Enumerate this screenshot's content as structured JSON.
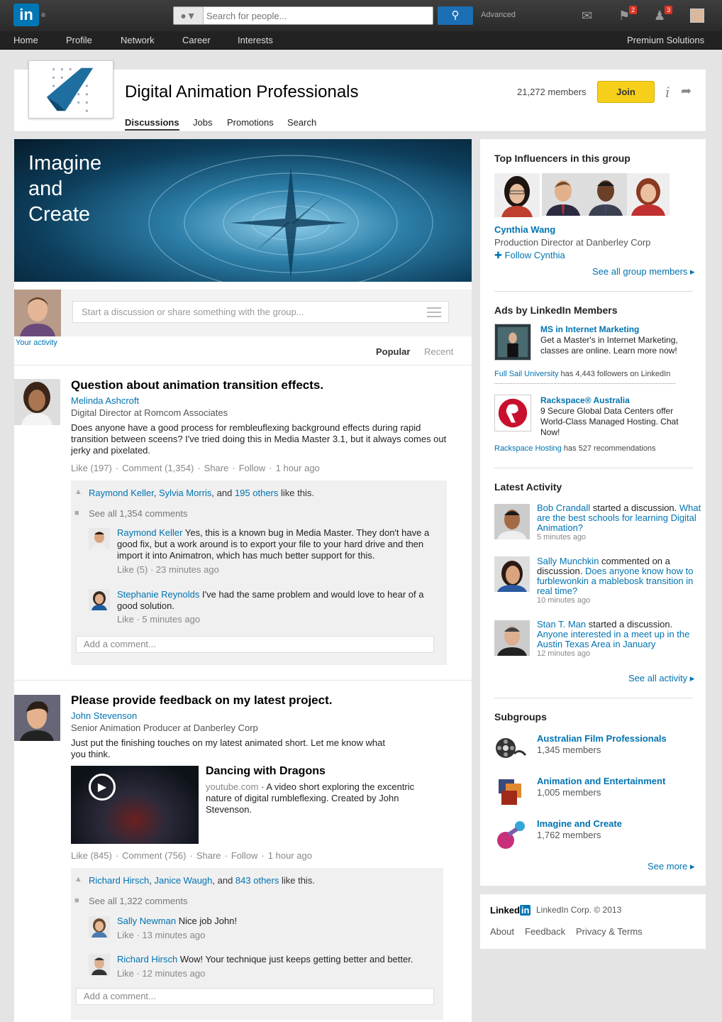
{
  "topbar": {
    "logo_text": "in",
    "search_placeholder": "Search for people...",
    "advanced_label": "Advanced",
    "flag_count": "2",
    "people_count": "3"
  },
  "nav": {
    "items": [
      "Home",
      "Profile",
      "Network",
      "Career",
      "Interests"
    ],
    "premium": "Premium Solutions"
  },
  "group": {
    "title": "Digital Animation Professionals",
    "members": "21,272 members",
    "join_label": "Join",
    "tabs": [
      "Discussions",
      "Jobs",
      "Promotions",
      "Search"
    ]
  },
  "hero": {
    "lines": [
      "Imagine",
      "and",
      "Create"
    ]
  },
  "share": {
    "placeholder": "Start a discussion or share something with the group...",
    "your_activity": "Your activity",
    "sort_popular": "Popular",
    "sort_recent": "Recent"
  },
  "posts": [
    {
      "title": "Question about animation transition effects.",
      "author": "Melinda Ashcroft",
      "role": "Digital Director at Romcom Associates",
      "body": "Does anyone have a good process for rembleuflexing background effects during rapid transition between sceens? I've tried doing this in Media Master 3.1, but it always comes out jerky and pixelated.",
      "like": "Like (197)",
      "comment": "Comment (1,354)",
      "share": "Share",
      "follow": "Follow",
      "time": "1 hour ago",
      "likers": [
        "Raymond Keller",
        "Sylvia Morris"
      ],
      "likers_and": ", and ",
      "likers_others": "195 others",
      "likers_suffix": " like this.",
      "see_all": "See all 1,354 comments",
      "comments": [
        {
          "name": "Raymond Keller",
          "text": " Yes, this is a known bug in Media Master. They don't have a good fix, but a work around is to export your file to your hard drive and then import it into Animatron, which has much better support for this.",
          "meta": "Like (5)  ·  23 minutes ago"
        },
        {
          "name": "Stephanie Reynolds",
          "text": " I've had the same problem and would love to hear of a good solution.",
          "meta": "Like  ·  5 minutes ago"
        }
      ],
      "add_comment": "Add a comment..."
    },
    {
      "title": "Please provide feedback on my latest project.",
      "author": "John Stevenson",
      "role": "Senior Animation Producer at Danberley Corp",
      "body": "Just put the finishing touches on my latest animated short. Let me know what you think.",
      "video_title": "Dancing with Dragons",
      "video_source": "youtube.com",
      "video_desc": "A video short exploring the excentric nature of digital rumbleflexing. Created by John Stevenson.",
      "like": "Like (845)",
      "comment": "Comment (756)",
      "share": "Share",
      "follow": "Follow",
      "time": "1 hour ago",
      "likers": [
        "Richard Hirsch",
        "Janice Waugh"
      ],
      "likers_and": ", and ",
      "likers_others": "843 others",
      "likers_suffix": " like this.",
      "see_all": "See all 1,322 comments",
      "comments": [
        {
          "name": "Sally Newman",
          "text": " Nice job John!",
          "meta": "Like  ·  13 minutes ago"
        },
        {
          "name": "Richard Hirsch",
          "text": " Wow! Your technique just keeps getting better and better.",
          "meta": "Like  ·  12 minutes ago"
        }
      ],
      "add_comment": "Add a comment..."
    }
  ],
  "influencers": {
    "heading": "Top Influencers in this group",
    "name": "Cynthia Wang",
    "role": "Production Director at Danberley Corp",
    "follow": "Follow Cynthia",
    "see_all": "See all group members"
  },
  "ads": {
    "heading": "Ads by LinkedIn Members",
    "items": [
      {
        "title": "MS in Internet Marketing",
        "body": "Get a Master's in Internet Marketing, classes are online. Learn more now!",
        "foot_link": "Full Sail University",
        "foot_text": " has 4,443 followers on LinkedIn"
      },
      {
        "title": "Rackspace® Australia",
        "body": "9 Secure Global Data Centers offer World-Class Managed Hosting. Chat Now!",
        "foot_link": "Rackspace Hosting",
        "foot_text": " has 527 recommendations"
      }
    ]
  },
  "activity": {
    "heading": "Latest Activity",
    "items": [
      {
        "name": "Bob Crandall",
        "action": " started a discussion.",
        "link": "What are the best schools for learning Digital Animation?",
        "time": "5 minutes ago"
      },
      {
        "name": "Sally Munchkin",
        "action": " commented on a discussion.",
        "link": "Does anyone know how to furblewonkin a mablebosk transition in real time?",
        "time": "10 minutes ago"
      },
      {
        "name": "Stan T. Man",
        "action": " started a discussion.",
        "link": "Anyone interested in a meet up in the Austin Texas Area in January",
        "time": "12 minutes ago"
      }
    ],
    "see_all": "See all activity"
  },
  "subgroups": {
    "heading": "Subgroups",
    "items": [
      {
        "name": "Australian Film Professionals",
        "count": "1,345 members"
      },
      {
        "name": "Animation and Entertainment",
        "count": "1,005 members"
      },
      {
        "name": "Imagine and Create",
        "count": "1,762 members"
      }
    ],
    "see_more": "See more"
  },
  "footer": {
    "brand": "Linked",
    "brand_in": "in",
    "copyright": "LinkedIn Corp. © 2013",
    "links": [
      "About",
      "Feedback",
      "Privacy & Terms"
    ]
  }
}
